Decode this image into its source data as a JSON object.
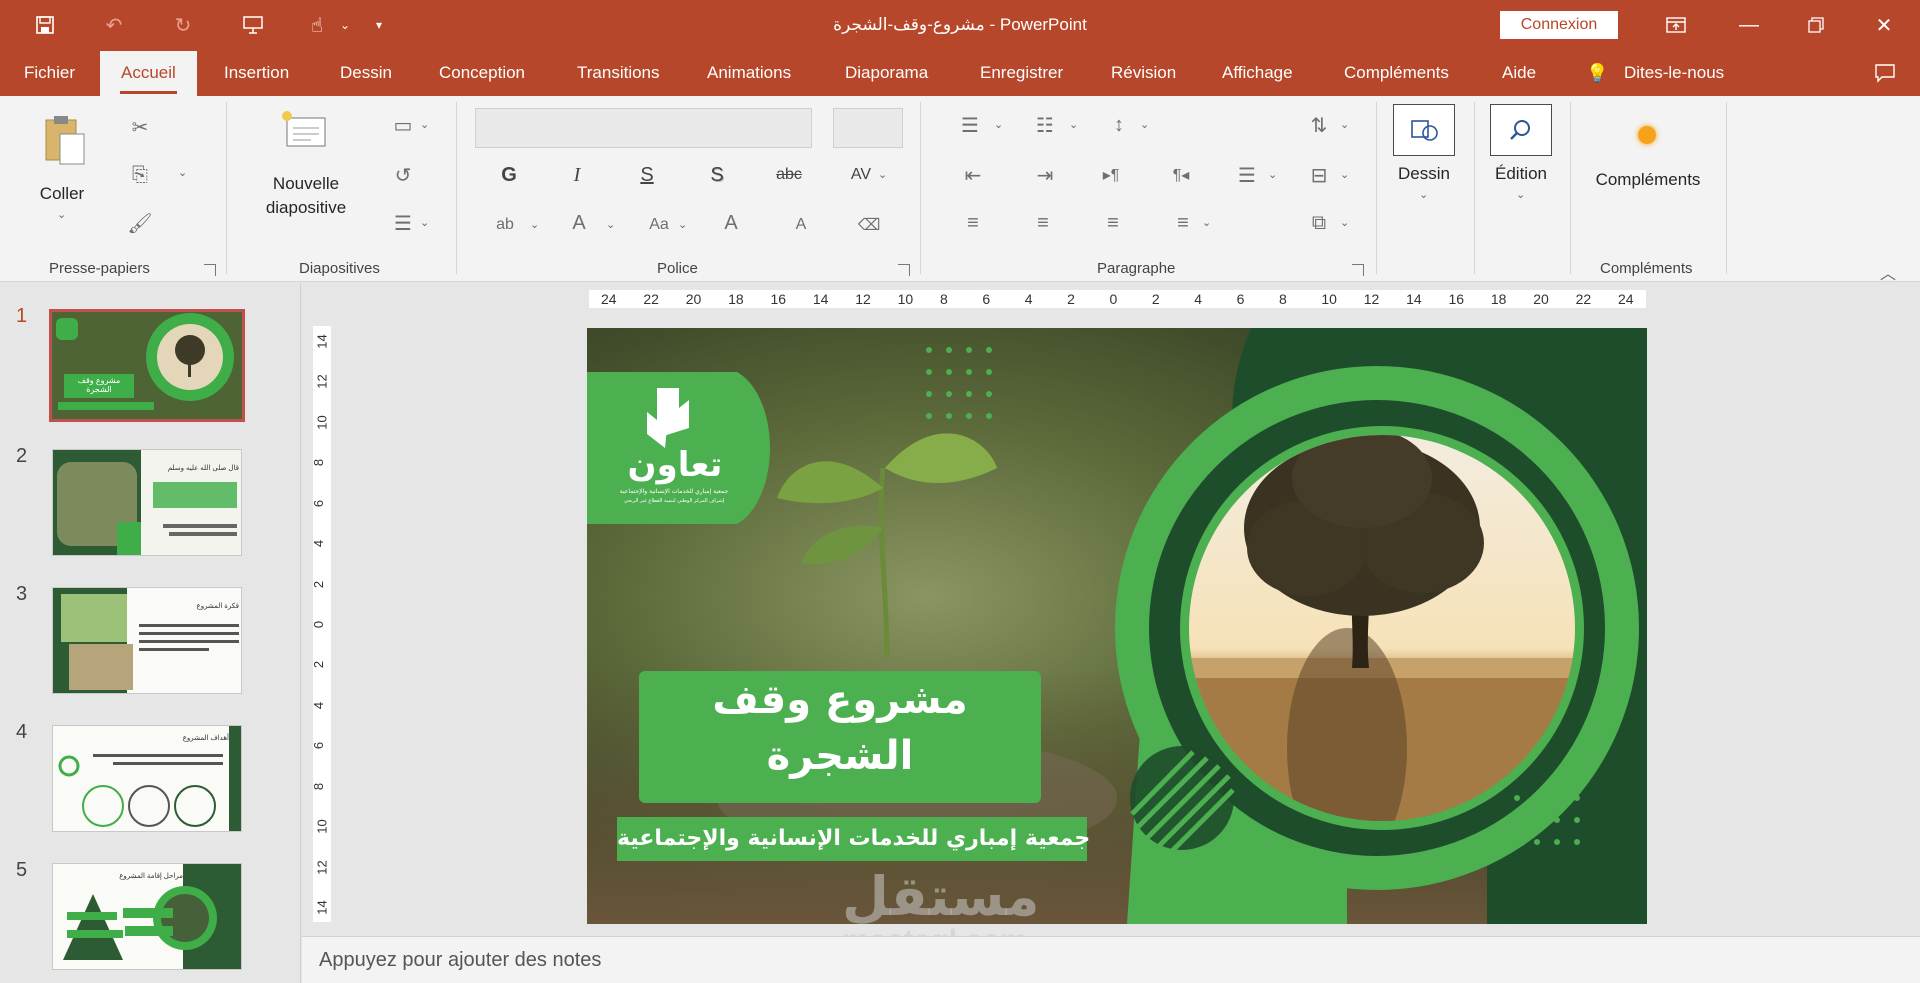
{
  "window": {
    "title": "مشروع-وقف-الشجرة  -  PowerPoint",
    "signin_label": "Connexion"
  },
  "tabs": [
    "Fichier",
    "Accueil",
    "Insertion",
    "Dessin",
    "Conception",
    "Transitions",
    "Animations",
    "Diaporama",
    "Enregistrer",
    "Révision",
    "Affichage",
    "Compléments",
    "Aide",
    "Dites-le-nous"
  ],
  "active_tab": "Accueil",
  "ribbon": {
    "clipboard": {
      "paste_label": "Coller",
      "group_label": "Presse-papiers"
    },
    "slides": {
      "new_slide_label": "Nouvelle diapositive",
      "group_label": "Diapositives"
    },
    "font": {
      "group_label": "Police",
      "bold": "G",
      "italic": "I",
      "underline": "S",
      "shadow": "S",
      "strike": "abc",
      "spacing": "AV",
      "font_color": "A",
      "case": "Aa",
      "grow": "A",
      "shrink": "A"
    },
    "paragraph": {
      "group_label": "Paragraphe"
    },
    "drawing": {
      "label": "Dessin"
    },
    "editing": {
      "label": "Édition"
    },
    "addins": {
      "label": "Compléments",
      "group_label": "Compléments"
    }
  },
  "rulers": {
    "horizontal_ticks": [
      "24",
      "22",
      "20",
      "18",
      "16",
      "14",
      "12",
      "10",
      "8",
      "6",
      "4",
      "2",
      "0",
      "2",
      "4",
      "6",
      "8",
      "10",
      "12",
      "14",
      "16",
      "18",
      "20",
      "22",
      "24"
    ],
    "vertical_ticks": [
      "14",
      "12",
      "10",
      "8",
      "6",
      "4",
      "2",
      "0",
      "2",
      "4",
      "6",
      "8",
      "10",
      "12",
      "14"
    ]
  },
  "thumbnails": [
    {
      "num": "1",
      "selected": true,
      "title": "مشروع وقف الشجرة"
    },
    {
      "num": "2",
      "selected": false,
      "title": "قال صلى الله عليه وسلم"
    },
    {
      "num": "3",
      "selected": false,
      "title": "فكرة المشروع"
    },
    {
      "num": "4",
      "selected": false,
      "title": "أهداف المشروع"
    },
    {
      "num": "5",
      "selected": false,
      "title": "مراحل إقامة المشروع"
    }
  ],
  "slide": {
    "title_line1": "مشروع وقف",
    "title_line2": "الشجرة",
    "subtitle": "جمعية إمباري للخدمات الإنسانية والإجتماعية",
    "logo_text": "تعاون",
    "logo_sub": "جمعية إمباري للخدمات الإنسانية والإجتماعية",
    "logo_sub2": "إشراف المركز الوطني لتنمية القطاع غير الربحي"
  },
  "notes_placeholder": "Appuyez pour ajouter des notes",
  "watermark": {
    "arabic": "مستقل",
    "latin": "mostaql.com"
  },
  "colors": {
    "accent": "#b7472a",
    "slide_green": "#4caf50",
    "dark_green": "#1e4d2b"
  }
}
